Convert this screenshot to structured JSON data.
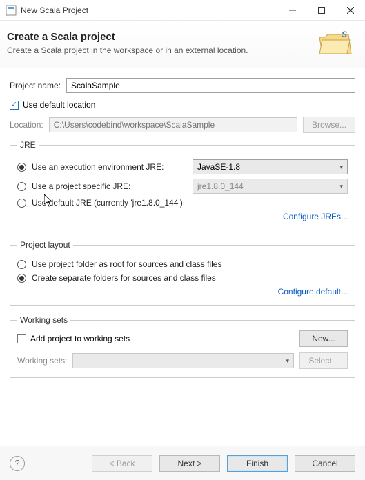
{
  "window": {
    "title": "New Scala Project"
  },
  "header": {
    "heading": "Create a Scala project",
    "subheading": "Create a Scala project in the workspace or in an external location."
  },
  "project": {
    "name_label": "Project name:",
    "name_value": "ScalaSample",
    "use_default_label": "Use default location",
    "use_default_checked": true,
    "location_label": "Location:",
    "location_value": "C:\\Users\\codebind\\workspace\\ScalaSample",
    "browse_label": "Browse..."
  },
  "jre": {
    "legend": "JRE",
    "opt_exec_env": "Use an execution environment JRE:",
    "exec_env_value": "JavaSE-1.8",
    "opt_project_specific": "Use a project specific JRE:",
    "project_specific_value": "jre1.8.0_144",
    "opt_default": "Use default JRE (currently 'jre1.8.0_144')",
    "configure_link": "Configure JREs..."
  },
  "layout": {
    "legend": "Project layout",
    "opt_root": "Use project folder as root for sources and class files",
    "opt_separate": "Create separate folders for sources and class files",
    "configure_link": "Configure default..."
  },
  "working_sets": {
    "legend": "Working sets",
    "add_label": "Add project to working sets",
    "new_label": "New...",
    "ws_label": "Working sets:",
    "select_label": "Select..."
  },
  "footer": {
    "back": "< Back",
    "next": "Next >",
    "finish": "Finish",
    "cancel": "Cancel"
  }
}
